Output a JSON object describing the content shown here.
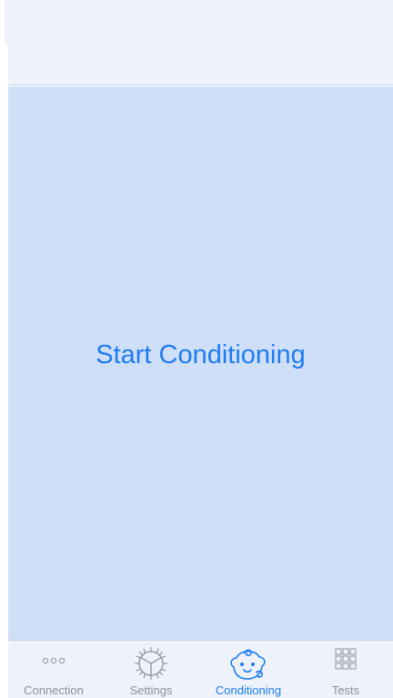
{
  "main": {
    "start_button_label": "Start Conditioning"
  },
  "tab_bar": {
    "active_index": 2,
    "active_color": "#1e7cf0",
    "inactive_color": "#8e8e93",
    "tabs": [
      {
        "label": "Connection",
        "icon": "ellipsis-dots-icon"
      },
      {
        "label": "Settings",
        "icon": "settings-gear-icon"
      },
      {
        "label": "Conditioning",
        "icon": "baby-face-icon"
      },
      {
        "label": "Tests",
        "icon": "grid-icon"
      }
    ]
  },
  "colors": {
    "content_background": "#cfdff8",
    "bar_background": "#eef3fb"
  }
}
